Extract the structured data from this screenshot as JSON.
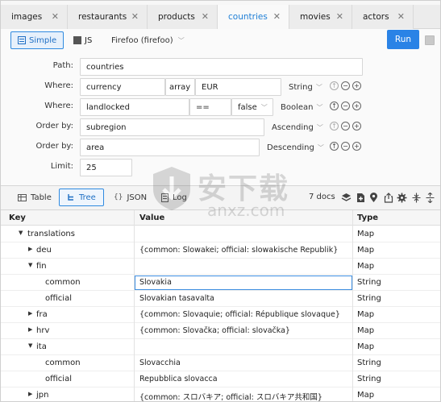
{
  "tabs": [
    {
      "label": "images",
      "active": false
    },
    {
      "label": "restaurants",
      "active": false
    },
    {
      "label": "products",
      "active": false
    },
    {
      "label": "countries",
      "active": true
    },
    {
      "label": "movies",
      "active": false
    },
    {
      "label": "actors",
      "active": false
    }
  ],
  "toolbar": {
    "simple_label": "Simple",
    "js_label": "JS",
    "environment": "Firefoo (firefoo)",
    "run_label": "Run"
  },
  "query": {
    "path_label": "Path:",
    "path_value": "countries",
    "where1": {
      "label": "Where:",
      "field": "currency",
      "operator": "array",
      "value": "EUR",
      "type": "String"
    },
    "where2": {
      "label": "Where:",
      "field": "landlocked",
      "operator": "==",
      "value": "false",
      "type": "Boolean"
    },
    "order1": {
      "label": "Order by:",
      "field": "subregion",
      "direction": "Ascending"
    },
    "order2": {
      "label": "Order by:",
      "field": "area",
      "direction": "Descending"
    },
    "limit_label": "Limit:",
    "limit_value": "25"
  },
  "results": {
    "views": [
      "Table",
      "Tree",
      "JSON",
      "Log"
    ],
    "active_view": "Tree",
    "doc_count": "7 docs"
  },
  "table": {
    "headers": {
      "key": "Key",
      "value": "Value",
      "type": "Type"
    },
    "rows": [
      {
        "key": "translations",
        "value": "",
        "type": "Map",
        "depth": 1,
        "expander": "open"
      },
      {
        "key": "deu",
        "value": "{common: Slowakei; official: slowakische Republik}",
        "type": "Map",
        "depth": 2,
        "expander": "closed"
      },
      {
        "key": "fin",
        "value": "",
        "type": "Map",
        "depth": 2,
        "expander": "open"
      },
      {
        "key": "common",
        "value": "Slovakia",
        "type": "String",
        "depth": 3,
        "expander": "none",
        "editing": true
      },
      {
        "key": "official",
        "value": "Slovakian tasavalta",
        "type": "String",
        "depth": 3,
        "expander": "none"
      },
      {
        "key": "fra",
        "value": "{common: Slovaquie; official: République slovaque}",
        "type": "Map",
        "depth": 2,
        "expander": "closed"
      },
      {
        "key": "hrv",
        "value": "{common: Slovačka; official: slovačka}",
        "type": "Map",
        "depth": 2,
        "expander": "closed"
      },
      {
        "key": "ita",
        "value": "",
        "type": "Map",
        "depth": 2,
        "expander": "open"
      },
      {
        "key": "common",
        "value": "Slovacchia",
        "type": "String",
        "depth": 3,
        "expander": "none"
      },
      {
        "key": "official",
        "value": "Repubblica slovacca",
        "type": "String",
        "depth": 3,
        "expander": "none"
      },
      {
        "key": "jpn",
        "value": "{common: スロバキア; official: スロバキア共和国}",
        "type": "Map",
        "depth": 2,
        "expander": "closed"
      }
    ]
  },
  "watermark": {
    "text": "安下载",
    "sub": "anxz.com"
  },
  "colors": {
    "accent": "#2a83e6",
    "active_tab_text": "#1f7fd6"
  }
}
